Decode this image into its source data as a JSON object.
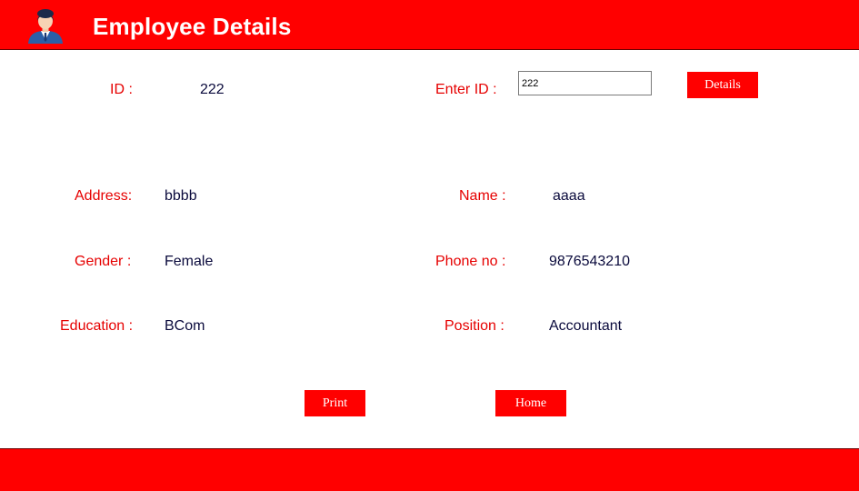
{
  "header": {
    "title": "Employee Details"
  },
  "lookup": {
    "enter_id_label": "Enter ID :",
    "enter_id_value": "222",
    "details_button": "Details"
  },
  "fields": {
    "id_label": "ID :",
    "id_value": "222",
    "address_label": "Address:",
    "address_value": "bbbb",
    "name_label": "Name :",
    "name_value": "aaaa",
    "gender_label": "Gender :",
    "gender_value": "Female",
    "phone_label": "Phone no :",
    "phone_value": "9876543210",
    "education_label": "Education :",
    "education_value": "BCom",
    "position_label": "Position :",
    "position_value": "Accountant"
  },
  "actions": {
    "print_button": "Print",
    "home_button": "Home"
  },
  "colors": {
    "accent": "#ff0000",
    "label": "#e60000",
    "value": "#0a0a3c"
  }
}
